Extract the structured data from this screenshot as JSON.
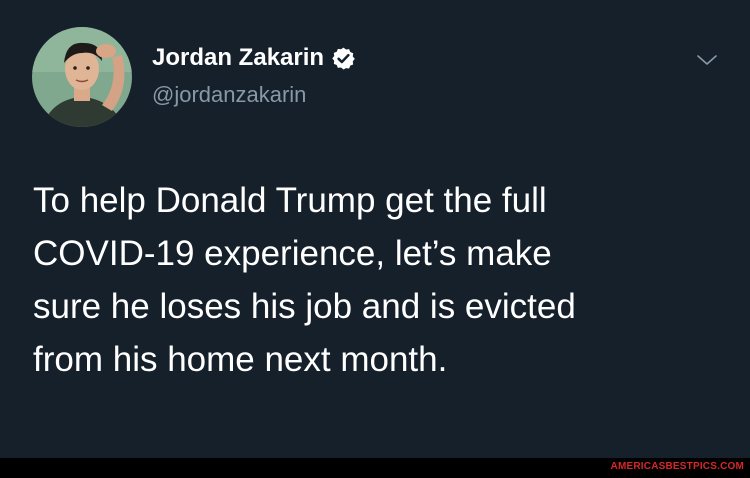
{
  "tweet": {
    "author_name": "Jordan Zakarin",
    "author_handle": "@jordanzakarin",
    "text": "To help Donald Trump get the full\nCOVID-19 experience, let’s make\nsure he loses his job and is evicted\nfrom his home next month.",
    "verified_icon": "verified-badge-icon",
    "menu_icon": "chevron-down-icon"
  },
  "footer": {
    "watermark": "AMERICASBESTPICS.COM"
  },
  "colors": {
    "background": "#15202b",
    "text": "#ffffff",
    "secondary_text": "#8899a6",
    "verified_blue": "#ffffff",
    "watermark": "#d62828"
  }
}
